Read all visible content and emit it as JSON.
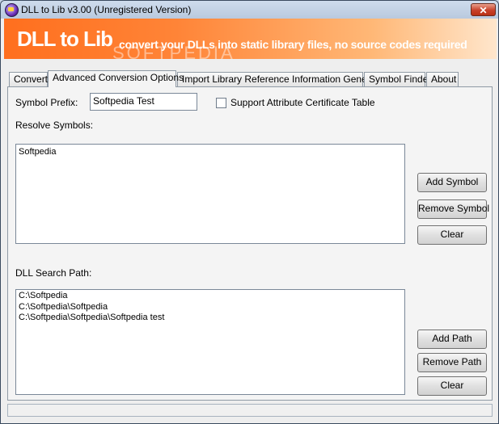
{
  "window": {
    "title": "DLL to Lib v3.00 (Unregistered Version)",
    "close_glyph": "✕"
  },
  "banner": {
    "title": "DLL to Lib",
    "tagline": "convert your DLLs into static library files, no source codes required",
    "watermark": "SOFTPEDIA"
  },
  "tabs": [
    {
      "label": "Convert"
    },
    {
      "label": "Advanced Conversion Options"
    },
    {
      "label": "Import Library Reference Information Generator"
    },
    {
      "label": "Symbol Finder"
    },
    {
      "label": "About"
    }
  ],
  "options": {
    "symbol_prefix_label": "Symbol Prefix:",
    "symbol_prefix_value": "Softpedia Test",
    "support_cert_label": "Support Attribute Certificate Table",
    "support_cert_checked": false,
    "resolve_symbols_label": "Resolve Symbols:",
    "resolve_symbols": [
      "Softpedia"
    ],
    "add_symbol_button": "Add Symbol",
    "remove_symbol_button": "Remove Symbol",
    "clear_symbols_button": "Clear",
    "dll_search_path_label": "DLL Search Path:",
    "search_paths": [
      "C:\\Softpedia",
      "C:\\Softpedia\\Softpedia",
      "C:\\Softpedia\\Softpedia\\Softpedia test"
    ],
    "add_path_button": "Add Path",
    "remove_path_button": "Remove Path",
    "clear_paths_button": "Clear"
  },
  "icons": {
    "app": "dll-to-lib-app-icon",
    "close": "close-icon",
    "checkbox": "checkbox-unchecked"
  }
}
